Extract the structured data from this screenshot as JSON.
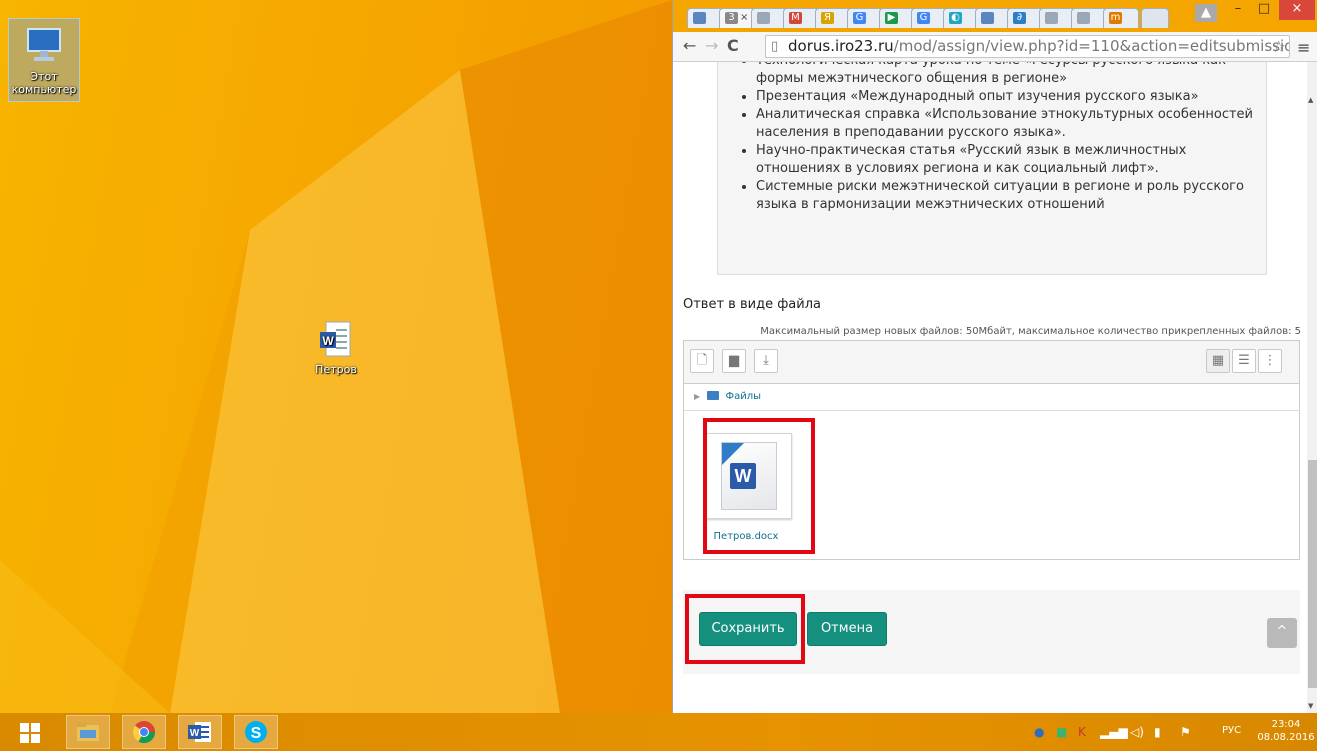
{
  "desktop": {
    "icons": [
      {
        "label": "Этот компьютер",
        "icon": "computer-icon"
      },
      {
        "label": "Петров",
        "icon": "word-document-icon"
      }
    ]
  },
  "browser": {
    "tabs": [
      {
        "icon_text": "",
        "label": "",
        "color": "#5a86c0"
      },
      {
        "icon_text": "3",
        "label": "×",
        "active": true,
        "color": "#888888"
      },
      {
        "icon_text": "",
        "label": "",
        "color": "#9aa7b5"
      },
      {
        "icon_text": "M",
        "label": "",
        "color": "#d44638"
      },
      {
        "icon_text": "Я",
        "label": "",
        "color": "#d9a400"
      },
      {
        "icon_text": "G",
        "label": "",
        "color": "#4285f4"
      },
      {
        "icon_text": "▶",
        "label": "",
        "color": "#1a9a4a"
      },
      {
        "icon_text": "G",
        "label": "",
        "color": "#4285f4"
      },
      {
        "icon_text": "◐",
        "label": "",
        "color": "#1fa6c4"
      },
      {
        "icon_text": "",
        "label": "",
        "color": "#5a86c0"
      },
      {
        "icon_text": "∂",
        "label": "",
        "color": "#2a7fc8"
      },
      {
        "icon_text": "",
        "label": "",
        "color": "#9aa7b5"
      },
      {
        "icon_text": "",
        "label": "",
        "color": "#9aa7b5"
      },
      {
        "icon_text": "m",
        "label": "",
        "color": "#e07b00"
      }
    ],
    "url_host": "dorus.iro23.ru",
    "url_path": "/mod/assign/view.php?id=110&action=editsubmission"
  },
  "page": {
    "description_items": [
      "Технологическая карта урока по теме «Ресурсы русского языка как формы межэтнического общения в регионе»",
      "Презентация «Международный опыт изучения русского языка»",
      "Аналитическая справка «Использование этнокультурных особенностей населения в преподавании русского языка».",
      "Научно-практическая статья «Русский язык в межличностных отношениях в условиях региона и как социальный лифт».",
      "Системные риски межэтнической ситуации в регионе и роль русского языка в гармонизации межэтнических отношений"
    ],
    "file_section_title": "Ответ в виде файла",
    "file_limits": "Максимальный размер новых файлов: 50Мбайт, максимальное количество прикрепленных файлов: 5",
    "breadcrumb_folder": "Файлы",
    "file_name": "Петров.docx",
    "doc_icon_letter": "W",
    "save_label": "Сохранить",
    "cancel_label": "Отмена"
  },
  "taskbar": {
    "language": "РУС",
    "time": "23:04",
    "date": "08.08.2016"
  },
  "colors": {
    "accent_button": "#15907f",
    "highlight": "#e30613",
    "link": "#0f6f8e"
  }
}
